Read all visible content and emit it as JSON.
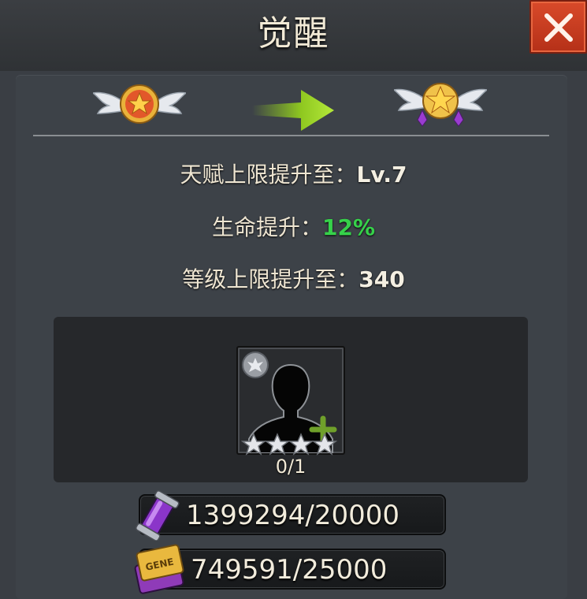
{
  "header": {
    "title": "觉醒"
  },
  "close": {
    "icon": "close-icon"
  },
  "awaken": {
    "from_badge": "winged-star-badge-icon",
    "arrow": "arrow-right-icon",
    "to_badge": "winged-star-gem-badge-icon"
  },
  "stats": [
    {
      "label": "天赋上限提升至：",
      "value": "Lv.7",
      "color": "#f4efe2"
    },
    {
      "label": "生命提升：",
      "value": "12%",
      "color": "#36d24a"
    },
    {
      "label": "等级上限提升至：",
      "value": "340",
      "color": "#f4efe2"
    }
  ],
  "hero": {
    "icon": "silhouette-hero-icon",
    "emblem": "faction-emblem-icon",
    "add_icon": "plus-icon",
    "stars": 4,
    "count": "0/1"
  },
  "resources": [
    {
      "icon": "purple-vial-icon",
      "text": "1399294/20000"
    },
    {
      "icon": "gene-card-icon",
      "gene_label": "GENE",
      "text": "749591/25000"
    }
  ],
  "colors": {
    "accent_green": "#36d24a",
    "close_red": "#c8391d",
    "arrow_green": "#8fc820"
  }
}
